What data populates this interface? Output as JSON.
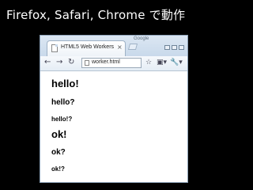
{
  "slide": {
    "title": "Firefox, Safari, Chrome で動作"
  },
  "browser": {
    "tab_title": "HTML5 Web Workers",
    "tab_close": "×",
    "brand": "Google",
    "address": "worker.html",
    "nav": {
      "back": "←",
      "forward": "→",
      "reload": "↻"
    },
    "toolbar": {
      "star": "☆",
      "page": "▣▾",
      "tools": "🔧▾"
    }
  },
  "content": {
    "lines": [
      {
        "text": "hello!"
      },
      {
        "text": "hello?"
      },
      {
        "text": "hello!?"
      },
      {
        "text": "ok!"
      },
      {
        "text": "ok?"
      },
      {
        "text": "ok!?"
      }
    ]
  }
}
